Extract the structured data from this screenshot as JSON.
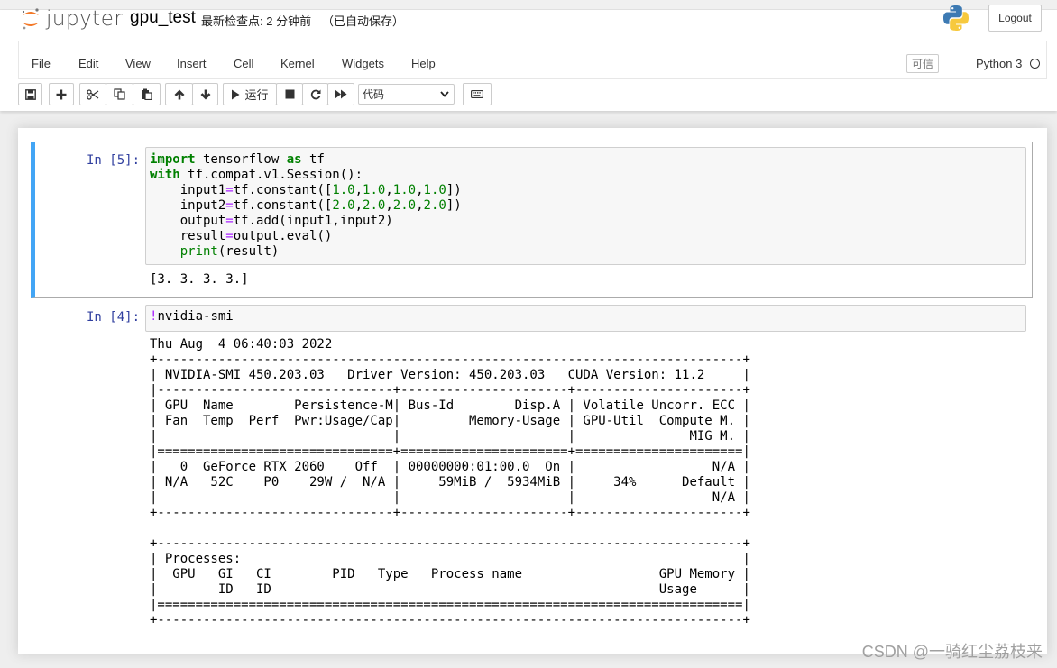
{
  "header": {
    "logo_text": "jupyter",
    "notebook_name": "gpu_test",
    "checkpoint": "最新检查点: 2 分钟前",
    "autosave": "（已自动保存）",
    "logout_label": "Logout"
  },
  "menu": {
    "items": [
      "File",
      "Edit",
      "View",
      "Insert",
      "Cell",
      "Kernel",
      "Widgets",
      "Help"
    ],
    "trusted_label": "可信",
    "kernel_name": "Python 3"
  },
  "toolbar": {
    "buttons": [
      "save-icon",
      "plus-icon",
      "cut-icon",
      "copy-icon",
      "paste-icon",
      "arrow-up-icon",
      "arrow-down-icon",
      "run-icon",
      "stop-icon",
      "restart-icon",
      "fast-forward-icon",
      "keyboard-icon"
    ],
    "run_label": "运行",
    "cell_type": "代码"
  },
  "cells": [
    {
      "prompt": "In [5]:",
      "code_lines": [
        "import tensorflow as tf",
        "with tf.compat.v1.Session():",
        "    input1=tf.constant([1.0,1.0,1.0,1.0])",
        "    input2=tf.constant([2.0,2.0,2.0,2.0])",
        "    output=tf.add(input1,input2)",
        "    result=output.eval()",
        "    print(result)"
      ],
      "output": "[3. 3. 3. 3.]"
    },
    {
      "prompt": "In [4]:",
      "code_lines": [
        "!nvidia-smi"
      ],
      "output_lines": [
        "Thu Aug  4 06:40:03 2022",
        "+-----------------------------------------------------------------------------+",
        "| NVIDIA-SMI 450.203.03   Driver Version: 450.203.03   CUDA Version: 11.2     |",
        "|-------------------------------+----------------------+----------------------+",
        "| GPU  Name        Persistence-M| Bus-Id        Disp.A | Volatile Uncorr. ECC |",
        "| Fan  Temp  Perf  Pwr:Usage/Cap|         Memory-Usage | GPU-Util  Compute M. |",
        "|                               |                      |               MIG M. |",
        "|===============================+======================+======================|",
        "|   0  GeForce RTX 2060    Off  | 00000000:01:00.0  On |                  N/A |",
        "| N/A   52C    P0    29W /  N/A |     59MiB /  5934MiB |     34%      Default |",
        "|                               |                      |                  N/A |",
        "+-------------------------------+----------------------+----------------------+",
        "",
        "+-----------------------------------------------------------------------------+",
        "| Processes:                                                                  |",
        "|  GPU   GI   CI        PID   Type   Process name                  GPU Memory |",
        "|        ID   ID                                                   Usage      |",
        "|=============================================================================|",
        "+-----------------------------------------------------------------------------+"
      ]
    }
  ],
  "watermark": "CSDN @一骑红尘荔枝来",
  "colors": {
    "accent_blue": "#42a5f5",
    "prompt_blue": "#303f9f",
    "keyword_green": "#008000",
    "operator_purple": "#aa22ff"
  }
}
